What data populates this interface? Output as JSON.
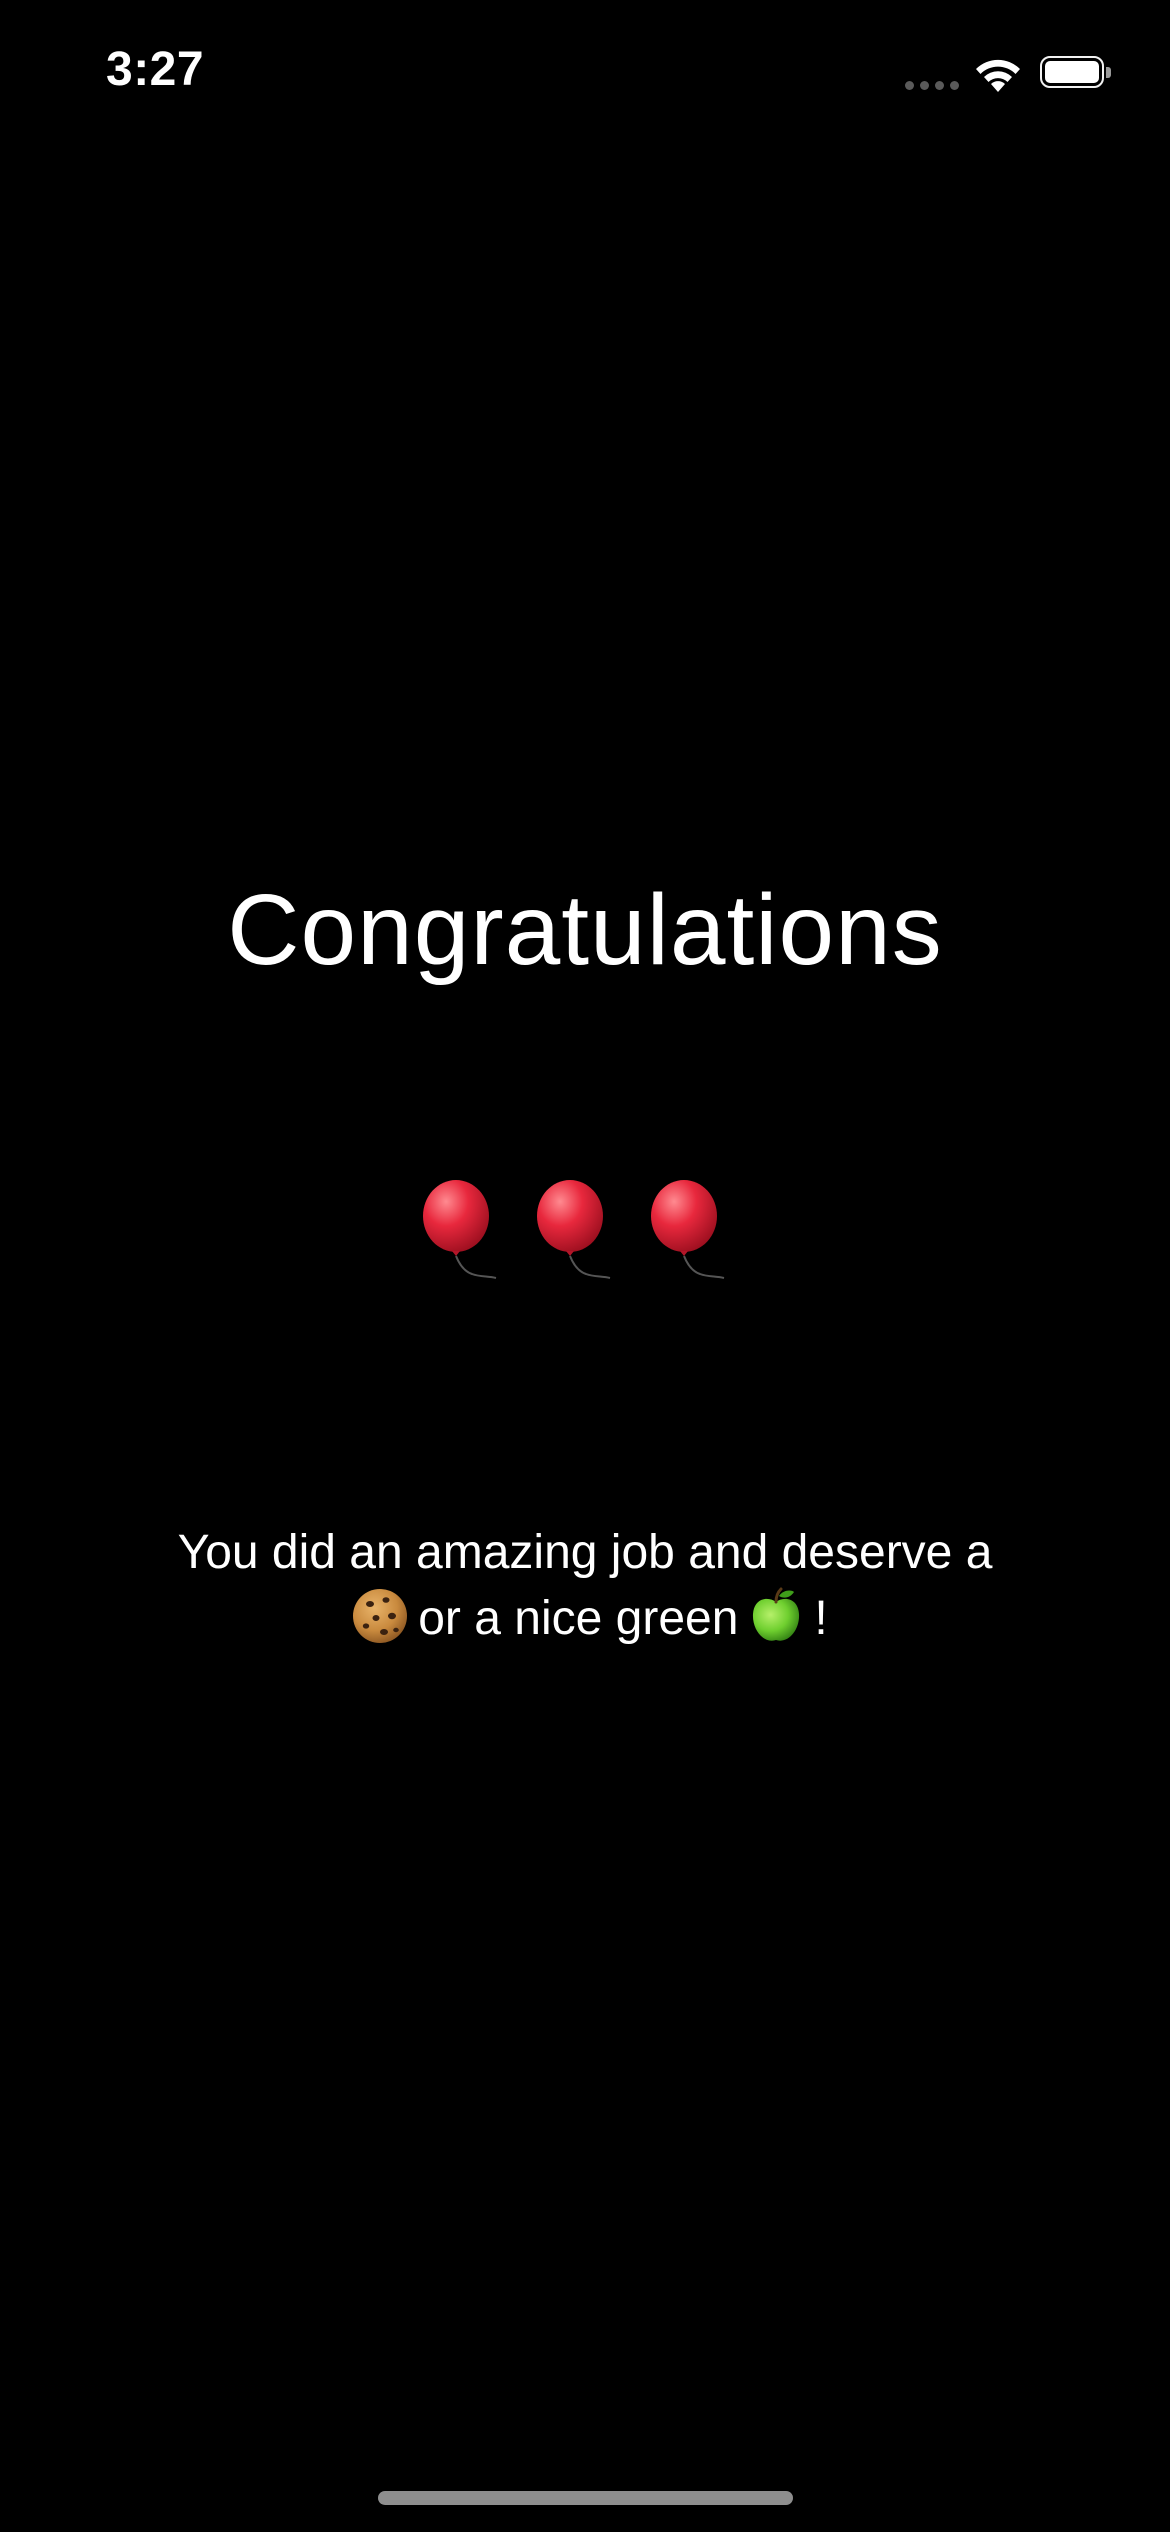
{
  "status_bar": {
    "time": "3:27",
    "signal_icon": "cellular-signal-icon",
    "wifi_icon": "wifi-icon",
    "battery_icon": "battery-icon"
  },
  "main": {
    "title": "Congratulations",
    "balloons": [
      {
        "icon": "red-balloon-icon"
      },
      {
        "icon": "red-balloon-icon"
      },
      {
        "icon": "red-balloon-icon"
      }
    ],
    "message": {
      "line1": "You did an amazing job and deserve a",
      "line2_before_icon": "",
      "cookie_icon": "cookie-icon",
      "line2_middle": "or a nice green",
      "apple_icon": "green-apple-icon",
      "line2_end": "!"
    }
  },
  "colors": {
    "background": "#000000",
    "text": "#ffffff",
    "balloon": "#e8283d",
    "apple": "#6fcf2f",
    "cookie": "#c98a3e",
    "home_indicator": "#8e8e8e"
  }
}
